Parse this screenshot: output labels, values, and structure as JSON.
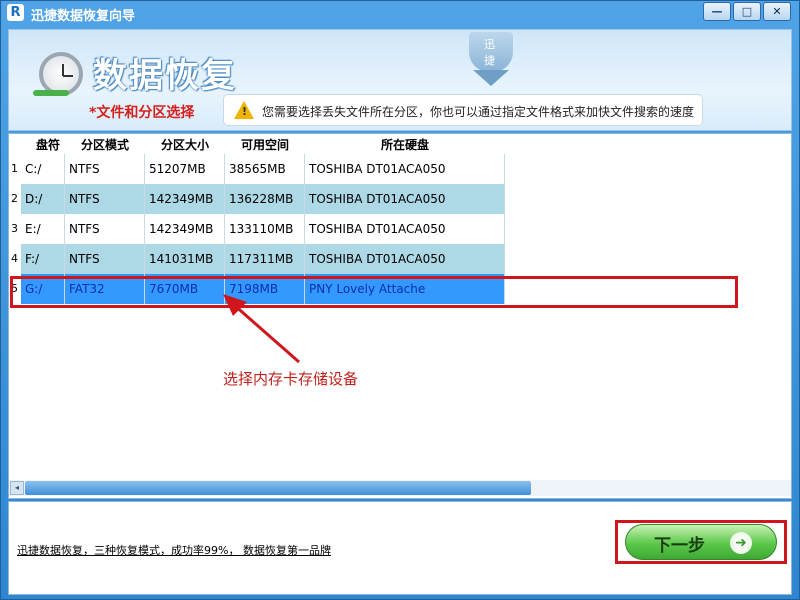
{
  "window": {
    "title": "迅捷数据恢复向导",
    "icon_letter": "R",
    "buttons": {
      "minimize": "—",
      "maximize": "□",
      "close": "✕"
    }
  },
  "banner": {
    "title": "数据恢复",
    "subtitle": "*文件和分区选择",
    "hint": "您需要选择丢失文件所在分区，你也可以通过指定文件格式来加快文件搜索的速度",
    "warn_symbol": "!",
    "logo_chars": [
      "迅",
      "捷"
    ]
  },
  "table": {
    "headers": [
      "盘符",
      "分区模式",
      "分区大小",
      "可用空间",
      "所在硬盘"
    ],
    "rows": [
      {
        "index": "1",
        "drive": "C:/",
        "mode": "NTFS",
        "size": "51207MB",
        "free": "38565MB",
        "disk": "TOSHIBA DT01ACA050"
      },
      {
        "index": "2",
        "drive": "D:/",
        "mode": "NTFS",
        "size": "142349MB",
        "free": "136228MB",
        "disk": "TOSHIBA DT01ACA050"
      },
      {
        "index": "3",
        "drive": "E:/",
        "mode": "NTFS",
        "size": "142349MB",
        "free": "133110MB",
        "disk": "TOSHIBA DT01ACA050"
      },
      {
        "index": "4",
        "drive": "F:/",
        "mode": "NTFS",
        "size": "141031MB",
        "free": "117311MB",
        "disk": "TOSHIBA DT01ACA050"
      },
      {
        "index": "5",
        "drive": "G:/",
        "mode": "FAT32",
        "size": "7670MB",
        "free": "7198MB",
        "disk": "PNY Lovely Attache"
      }
    ],
    "selected_index": 5,
    "scroll_left_symbol": "◂"
  },
  "annotation": {
    "callout": "选择内存卡存储设备"
  },
  "footer": {
    "link": "迅捷数据恢复，三种恢复模式，成功率99%， 数据恢复第一品牌",
    "next_label": "下一步",
    "next_arrow": "➜"
  },
  "colors": {
    "row_alt": "#add8e6",
    "row_selected": "#3399ff",
    "highlight_red": "#d0161c",
    "subtitle_red": "#d6201c"
  }
}
